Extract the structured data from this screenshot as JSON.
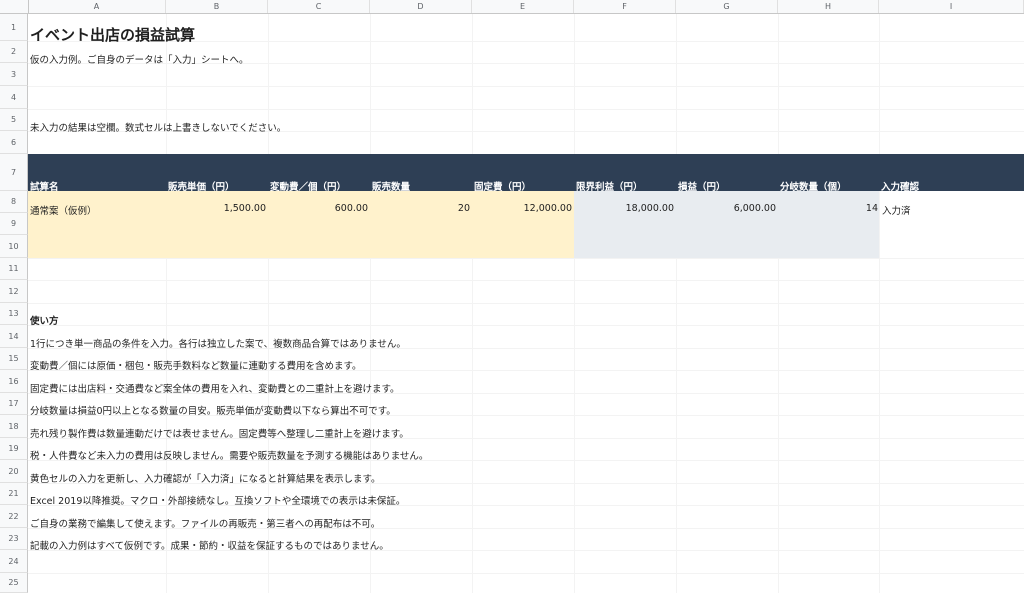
{
  "columns": [
    "A",
    "B",
    "C",
    "D",
    "E",
    "F",
    "G",
    "H",
    "I"
  ],
  "rows": [
    "1",
    "2",
    "3",
    "4",
    "5",
    "6",
    "7",
    "8",
    "9",
    "10",
    "11",
    "12",
    "13",
    "14",
    "15",
    "16",
    "17",
    "18",
    "19",
    "20",
    "21",
    "22",
    "23",
    "24",
    "25"
  ],
  "title": "イベント出店の損益試算",
  "subtitle": "仮の入力例。ご自身のデータは「入力」シートへ。",
  "note": "未入力の結果は空欄。数式セルは上書きしないでください。",
  "headers": {
    "a": "試算名",
    "b": "販売単価（円）",
    "c": "変動費／個（円）",
    "d": "販売数量",
    "e": "固定費（円）",
    "f": "限界利益（円）",
    "g": "損益（円）",
    "h": "分岐数量（個）",
    "i": "入力確認"
  },
  "row8": {
    "a": "通常案（仮例）",
    "b": "1,500.00",
    "c": "600.00",
    "d": "20",
    "e": "12,000.00",
    "f": "18,000.00",
    "g": "6,000.00",
    "h": "14",
    "i": "入力済"
  },
  "howto_title": "使い方",
  "howto": [
    "1行につき単一商品の条件を入力。各行は独立した案で、複数商品合算ではありません。",
    "変動費／個には原価・梱包・販売手数料など数量に連動する費用を含めます。",
    "固定費には出店料・交通費など案全体の費用を入れ、変動費との二重計上を避けます。",
    "分岐数量は損益0円以上となる数量の目安。販売単価が変動費以下なら算出不可です。",
    "売れ残り製作費は数量連動だけでは表せません。固定費等へ整理し二重計上を避けます。",
    "税・人件費など未入力の費用は反映しません。需要や販売数量を予測する機能はありません。",
    "黄色セルの入力を更新し、入力確認が「入力済」になると計算結果を表示します。",
    "Excel 2019以降推奨。マクロ・外部接続なし。互換ソフトや全環境での表示は未保証。",
    "ご自身の業務で編集して使えます。ファイルの再販売・第三者への再配布は不可。",
    "記載の入力例はすべて仮例です。成果・節約・収益を保証するものではありません。"
  ],
  "colors": {
    "header_band": "#2e3f55",
    "input_fill": "#fff2cc",
    "calc_fill": "#e8ecf0"
  }
}
